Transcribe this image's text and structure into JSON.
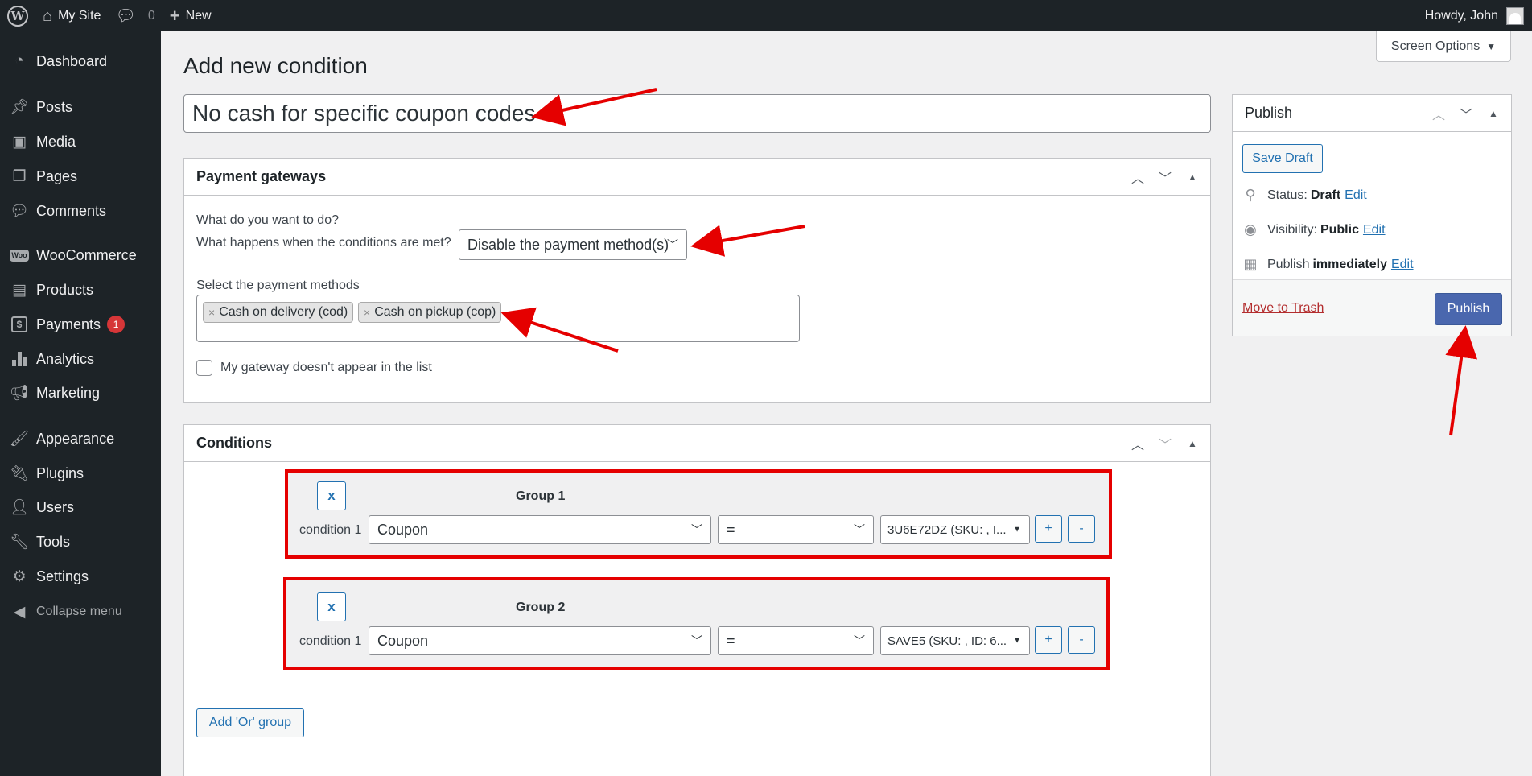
{
  "adminbar": {
    "site_name": "My Site",
    "comments_count": "0",
    "new_label": "New",
    "howdy": "Howdy, John"
  },
  "sidebar": {
    "items": [
      {
        "label": "Dashboard",
        "icon": "dashboard-icon"
      },
      {
        "label": "Posts",
        "icon": "pin-icon"
      },
      {
        "label": "Media",
        "icon": "media-icon"
      },
      {
        "label": "Pages",
        "icon": "pages-icon"
      },
      {
        "label": "Comments",
        "icon": "comment-icon"
      },
      {
        "label": "WooCommerce",
        "icon": "woo-icon"
      },
      {
        "label": "Products",
        "icon": "archive-icon"
      },
      {
        "label": "Payments",
        "icon": "payments-icon",
        "badge": "1"
      },
      {
        "label": "Analytics",
        "icon": "bar-chart-icon"
      },
      {
        "label": "Marketing",
        "icon": "megaphone-icon"
      },
      {
        "label": "Appearance",
        "icon": "brush-icon"
      },
      {
        "label": "Plugins",
        "icon": "plug-icon"
      },
      {
        "label": "Users",
        "icon": "user-icon"
      },
      {
        "label": "Tools",
        "icon": "wrench-icon"
      },
      {
        "label": "Settings",
        "icon": "settings-icon"
      },
      {
        "label": "Collapse menu",
        "icon": "collapse-icon"
      }
    ]
  },
  "screen_options": "Screen Options",
  "page_title": "Add new condition",
  "post_title": "No cash for specific coupon codes",
  "payment_gateways": {
    "title": "Payment gateways",
    "question": "What do you want to do?",
    "when_label": "What happens when the conditions are met?",
    "action_value": "Disable the payment method(s)",
    "methods_label": "Select the payment methods",
    "chips": [
      "Cash on delivery (cod)",
      "Cash on pickup (cop)"
    ],
    "checkbox_label": "My gateway doesn't appear in the list"
  },
  "conditions": {
    "title": "Conditions",
    "groups": [
      {
        "title": "Group 1",
        "remove": "x",
        "condition_label": "condition 1",
        "field": "Coupon",
        "operator": "=",
        "value": "3U6E72DZ (SKU: , I...",
        "add": "+",
        "minus": "-"
      },
      {
        "title": "Group 2",
        "remove": "x",
        "condition_label": "condition 1",
        "field": "Coupon",
        "operator": "=",
        "value": "SAVE5 (SKU: , ID: 6...",
        "add": "+",
        "minus": "-"
      }
    ],
    "add_or_group": "Add 'Or' group"
  },
  "publish": {
    "title": "Publish",
    "save_draft": "Save Draft",
    "status_label": "Status:",
    "status_value": "Draft",
    "visibility_label": "Visibility:",
    "visibility_value": "Public",
    "publish_label": "Publish",
    "publish_value": "immediately",
    "edit": "Edit",
    "move_to_trash": "Move to Trash",
    "publish_button": "Publish"
  },
  "colors": {
    "sidebar_bg": "#1d2327",
    "accent": "#2271b1",
    "annotation_red": "#e50000",
    "primary_button": "#4a67ae"
  }
}
